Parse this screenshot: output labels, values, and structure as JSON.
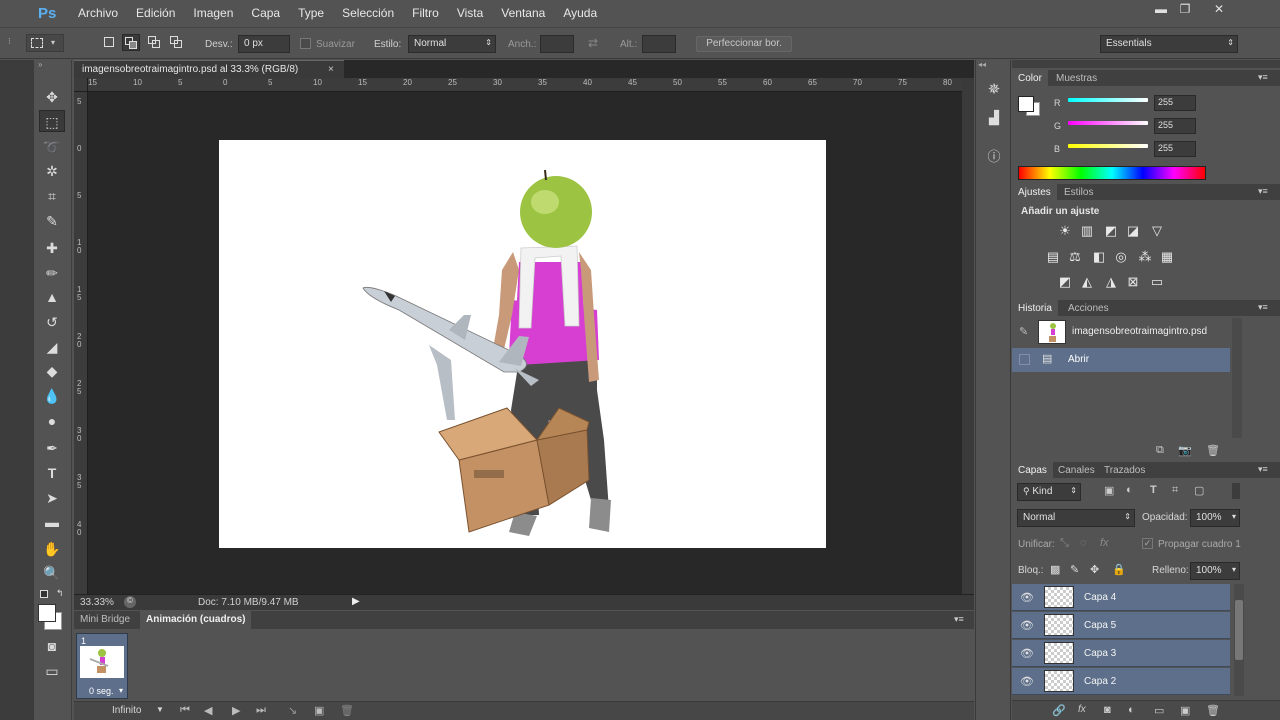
{
  "app": {
    "logo": "Ps"
  },
  "menu": [
    "Archivo",
    "Edición",
    "Imagen",
    "Capa",
    "Type",
    "Selección",
    "Filtro",
    "Vista",
    "Ventana",
    "Ayuda"
  ],
  "window_controls": {
    "minimize": "▬",
    "restore": "❐",
    "close": "✕"
  },
  "options": {
    "feather_label": "Desv.:",
    "feather_value": "0 px",
    "smooth_label": "Suavizar",
    "style_label": "Estilo:",
    "style_value": "Normal",
    "width_label": "Anch.:",
    "height_label": "Alt.:",
    "refine_button": "Perfeccionar bor.",
    "workspace": "Essentials"
  },
  "document": {
    "tab_title": "imagensobreotraimagintro.psd al 33.3% (RGB/8)",
    "zoom": "33.33%",
    "doc_size": "Doc: 7.10 MB/9.47 MB",
    "ruler_top": [
      "15",
      "10",
      "5",
      "0",
      "5",
      "10",
      "15",
      "20",
      "25",
      "30",
      "35",
      "40",
      "45",
      "50",
      "55",
      "60",
      "65",
      "70",
      "75",
      "80"
    ],
    "ruler_left": [
      "5",
      "0",
      "5",
      "1 0",
      "1 5",
      "2 0",
      "2 5",
      "3 0",
      "3 5",
      "4 0"
    ]
  },
  "bottom_panel": {
    "tabs": [
      "Mini Bridge",
      "Animación (cuadros)"
    ],
    "frame_number": "1",
    "frame_delay": "0 seg.",
    "loop": "Infinito"
  },
  "color_panel": {
    "tabs": [
      "Color",
      "Muestras"
    ],
    "channels": [
      {
        "label": "R",
        "value": "255"
      },
      {
        "label": "G",
        "value": "255"
      },
      {
        "label": "B",
        "value": "255"
      }
    ]
  },
  "adjustments_panel": {
    "tabs": [
      "Ajustes",
      "Estilos"
    ],
    "heading": "Añadir un ajuste"
  },
  "history_panel": {
    "tabs": [
      "Historia",
      "Acciones"
    ],
    "snapshot": "imagensobreotraimagintro.psd",
    "items": [
      "Abrir"
    ]
  },
  "layers_panel": {
    "tabs": [
      "Capas",
      "Canales",
      "Trazados"
    ],
    "kind": "Kind",
    "blend_mode": "Normal",
    "opacity_label": "Opacidad:",
    "opacity_value": "100%",
    "unify_label": "Unificar:",
    "propagate_label": "Propagar cuadro 1",
    "lock_label": "Bloq.:",
    "fill_label": "Relleno:",
    "fill_value": "100%",
    "layers": [
      {
        "name": "Capa 4"
      },
      {
        "name": "Capa 5"
      },
      {
        "name": "Capa 3"
      },
      {
        "name": "Capa 2"
      }
    ]
  },
  "colors": {
    "accent": "#5d6f8a",
    "panel": "#535353",
    "dark": "#282828"
  }
}
